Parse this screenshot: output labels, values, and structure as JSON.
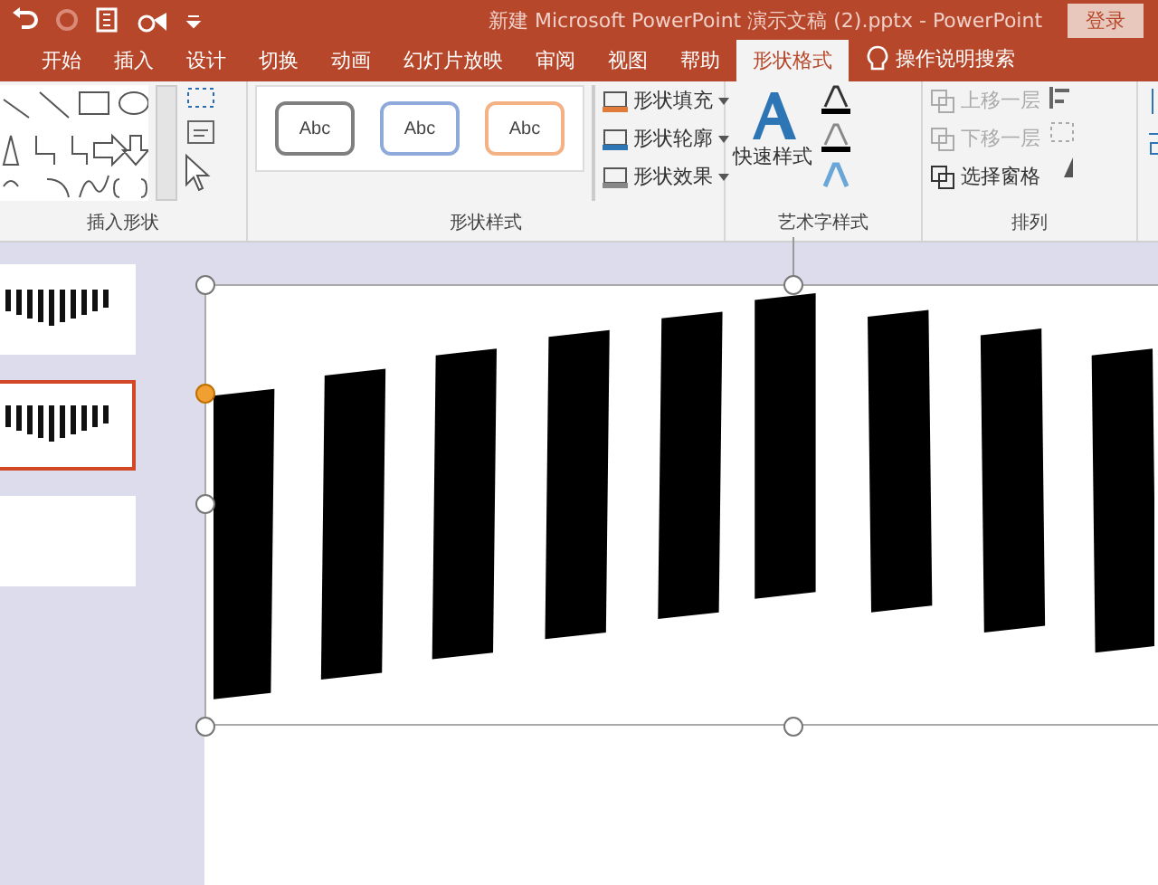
{
  "window": {
    "title": "新建 Microsoft PowerPoint 演示文稿 (2).pptx  -  PowerPoint",
    "login": "登录"
  },
  "tabs": [
    {
      "label": "开始",
      "selected": false
    },
    {
      "label": "插入",
      "selected": false
    },
    {
      "label": "设计",
      "selected": false
    },
    {
      "label": "切换",
      "selected": false
    },
    {
      "label": "动画",
      "selected": false
    },
    {
      "label": "幻灯片放映",
      "selected": false
    },
    {
      "label": "审阅",
      "selected": false
    },
    {
      "label": "视图",
      "selected": false
    },
    {
      "label": "帮助",
      "selected": false
    },
    {
      "label": "形状格式",
      "selected": true
    }
  ],
  "tell_me": "操作说明搜索",
  "ribbon": {
    "insert_shapes": {
      "label": "插入形状"
    },
    "shape_styles": {
      "label": "形状样式",
      "presets": [
        {
          "label": "Abc",
          "color": "#7f7f7f"
        },
        {
          "label": "Abc",
          "color": "#8eaadb"
        },
        {
          "label": "Abc",
          "color": "#f4b183"
        }
      ],
      "commands": [
        {
          "label": "形状填充"
        },
        {
          "label": "形状轮廓"
        },
        {
          "label": "形状效果"
        }
      ]
    },
    "wordart_styles": {
      "label": "艺术字样式",
      "quick_styles": "快速样式"
    },
    "arrange": {
      "label": "排列",
      "commands": [
        {
          "label": "上移一层",
          "disabled": true
        },
        {
          "label": "下移一层",
          "disabled": true
        },
        {
          "label": "选择窗格",
          "disabled": false
        }
      ]
    }
  },
  "slides": [
    {
      "selected": false
    },
    {
      "selected": true
    },
    {
      "selected": false
    }
  ]
}
